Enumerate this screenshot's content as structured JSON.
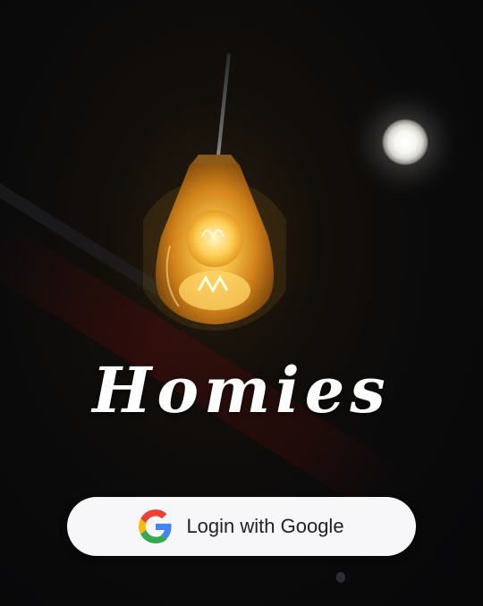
{
  "app": {
    "title": "Homies"
  },
  "login": {
    "button_label": "Login with Google",
    "icon": "google-icon"
  },
  "colors": {
    "background": "#0a0a0b",
    "button_bg": "#f7f7fa",
    "button_text": "#222222",
    "title": "#ffffff",
    "lamp_glow": "#f2b233"
  }
}
